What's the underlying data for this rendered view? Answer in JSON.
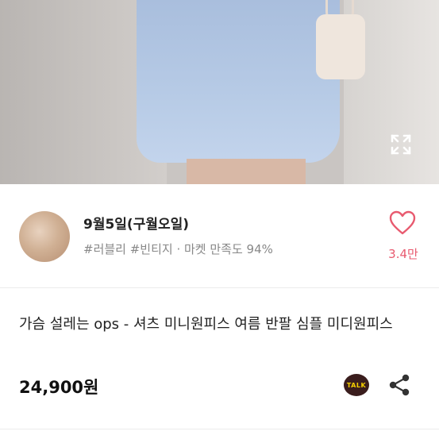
{
  "product_image": {
    "expand_icon": "expand-icon"
  },
  "seller": {
    "name": "9월5일(구월오일)",
    "tags_and_rating": "#러블리 #빈티지 · 마켓 만족도 94%",
    "like_count": "3.4만",
    "heart_icon": "heart-icon",
    "accent_color": "#e85a6f"
  },
  "product": {
    "title": "가슴 설레는 ops - 셔츠 미니원피스 여름 반팔 심플 미디원피스",
    "price": "24,900원"
  },
  "actions": {
    "kakao_talk_label": "TALK",
    "share_icon": "share-icon"
  }
}
